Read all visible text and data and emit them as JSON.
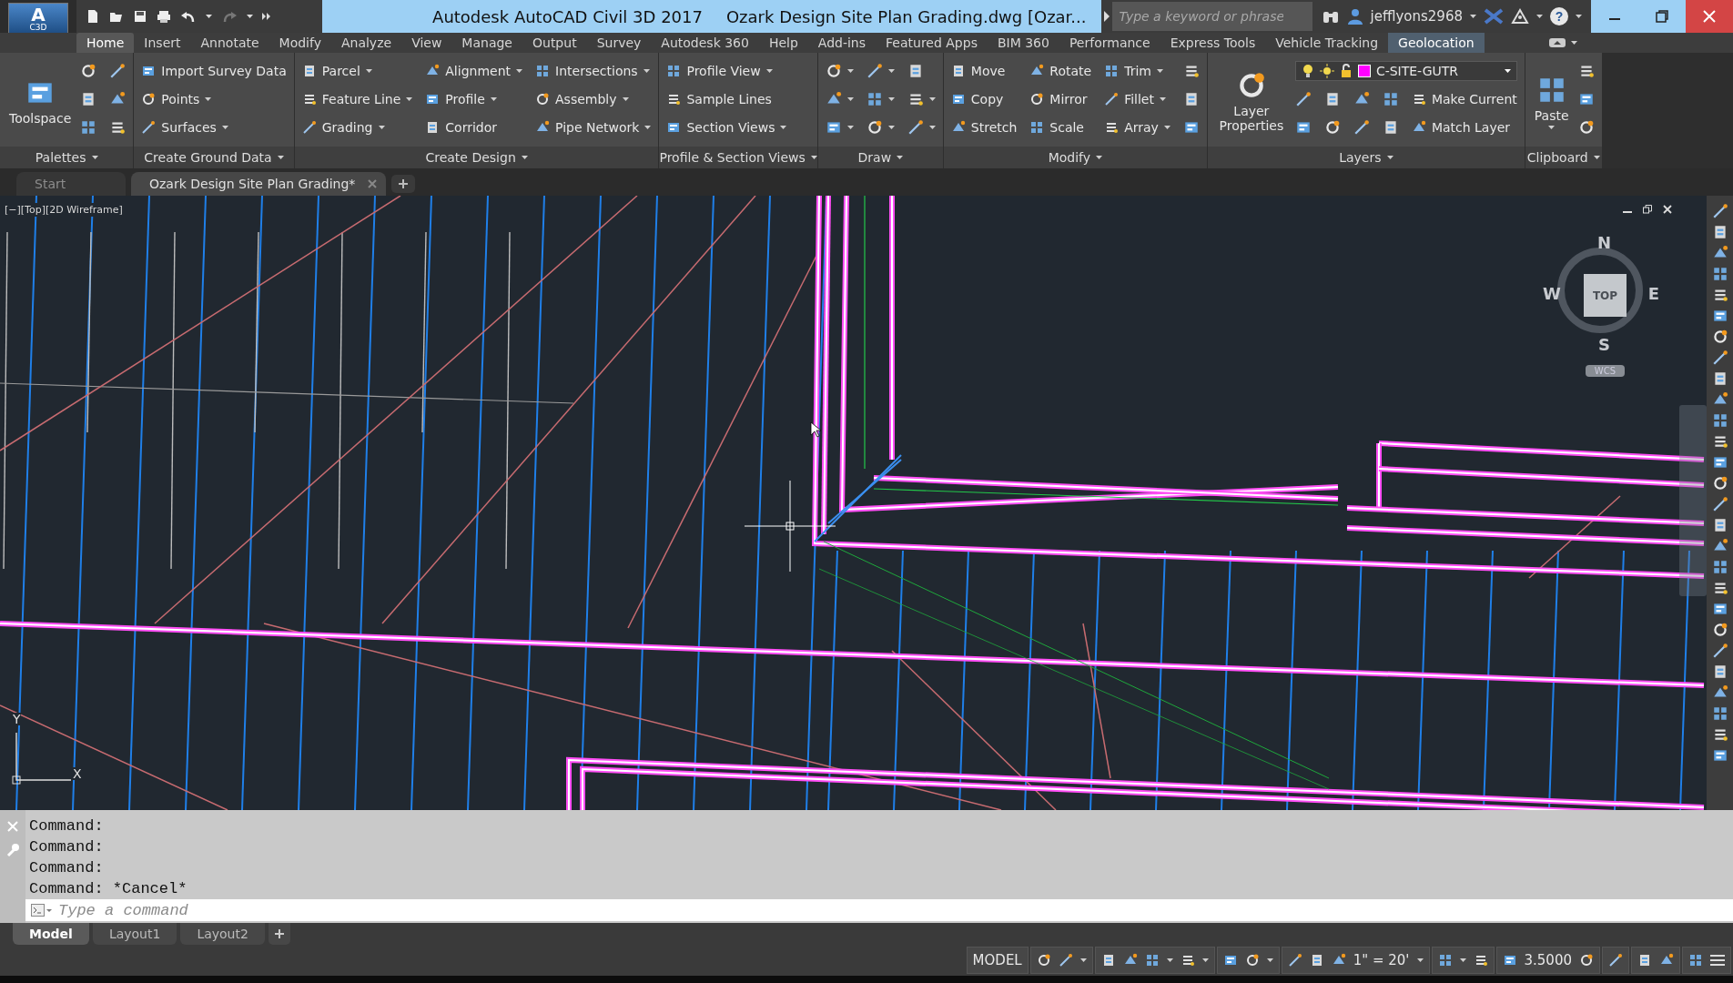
{
  "app_button": {
    "letter": "A",
    "product": "C3D"
  },
  "title": {
    "app": "Autodesk AutoCAD Civil 3D 2017",
    "document": "Ozark Design Site Plan Grading.dwg [Ozar..."
  },
  "search": {
    "placeholder": "Type a keyword or phrase"
  },
  "user": {
    "name": "jefflyons2968"
  },
  "help_button": {
    "label": "?"
  },
  "ribbon_tabs": [
    {
      "label": "Home",
      "selected": true,
      "highlighted": false
    },
    {
      "label": "Insert",
      "selected": false,
      "highlighted": false
    },
    {
      "label": "Annotate",
      "selected": false,
      "highlighted": false
    },
    {
      "label": "Modify",
      "selected": false,
      "highlighted": false
    },
    {
      "label": "Analyze",
      "selected": false,
      "highlighted": false
    },
    {
      "label": "View",
      "selected": false,
      "highlighted": false
    },
    {
      "label": "Manage",
      "selected": false,
      "highlighted": false
    },
    {
      "label": "Output",
      "selected": false,
      "highlighted": false
    },
    {
      "label": "Survey",
      "selected": false,
      "highlighted": false
    },
    {
      "label": "Autodesk 360",
      "selected": false,
      "highlighted": false
    },
    {
      "label": "Help",
      "selected": false,
      "highlighted": false
    },
    {
      "label": "Add-ins",
      "selected": false,
      "highlighted": false
    },
    {
      "label": "Featured Apps",
      "selected": false,
      "highlighted": false
    },
    {
      "label": "BIM 360",
      "selected": false,
      "highlighted": false
    },
    {
      "label": "Performance",
      "selected": false,
      "highlighted": false
    },
    {
      "label": "Express Tools",
      "selected": false,
      "highlighted": false
    },
    {
      "label": "Vehicle Tracking",
      "selected": false,
      "highlighted": false
    },
    {
      "label": "Geolocation",
      "selected": false,
      "highlighted": true
    }
  ],
  "ribbon_panels": [
    {
      "title": "Palettes",
      "large": [
        {
          "label": "Toolspace",
          "dropdown": false
        }
      ],
      "rows": [
        [
          {
            "kind": "icon",
            "dropdown": false
          },
          {
            "kind": "icon",
            "dropdown": false
          }
        ],
        [
          {
            "kind": "icon",
            "dropdown": false
          },
          {
            "kind": "icon",
            "dropdown": false
          }
        ],
        [
          {
            "kind": "icon",
            "dropdown": false
          },
          {
            "kind": "icon",
            "dropdown": false
          }
        ]
      ]
    },
    {
      "title": "Create Ground Data",
      "rows": [
        [
          {
            "kind": "tool",
            "label": "Import Survey Data",
            "dropdown": false
          }
        ],
        [
          {
            "kind": "tool",
            "label": "Points",
            "dropdown": true
          }
        ],
        [
          {
            "kind": "tool",
            "label": "Surfaces",
            "dropdown": true
          }
        ]
      ]
    },
    {
      "title": "Create Design",
      "rows": [
        [
          {
            "kind": "tool",
            "label": "Parcel",
            "dropdown": true
          },
          {
            "kind": "tool",
            "label": "Alignment",
            "dropdown": true
          },
          {
            "kind": "tool",
            "label": "Intersections",
            "dropdown": true
          }
        ],
        [
          {
            "kind": "tool",
            "label": "Feature Line",
            "dropdown": true
          },
          {
            "kind": "tool",
            "label": "Profile",
            "dropdown": true
          },
          {
            "kind": "tool",
            "label": "Assembly",
            "dropdown": true
          }
        ],
        [
          {
            "kind": "tool",
            "label": "Grading",
            "dropdown": true
          },
          {
            "kind": "tool",
            "label": "Corridor",
            "dropdown": false
          },
          {
            "kind": "tool",
            "label": "Pipe Network",
            "dropdown": true
          }
        ]
      ]
    },
    {
      "title": "Profile & Section Views",
      "rows": [
        [
          {
            "kind": "tool",
            "label": "Profile View",
            "dropdown": true
          }
        ],
        [
          {
            "kind": "tool",
            "label": "Sample Lines",
            "dropdown": false
          }
        ],
        [
          {
            "kind": "tool",
            "label": "Section Views",
            "dropdown": true
          }
        ]
      ]
    },
    {
      "title": "Draw",
      "rows": [
        [
          {
            "kind": "icon",
            "dropdown": true
          },
          {
            "kind": "icon",
            "dropdown": true
          },
          {
            "kind": "icon",
            "dropdown": false
          }
        ],
        [
          {
            "kind": "icon",
            "dropdown": true
          },
          {
            "kind": "icon",
            "dropdown": true
          },
          {
            "kind": "icon",
            "dropdown": true
          }
        ],
        [
          {
            "kind": "icon",
            "dropdown": true
          },
          {
            "kind": "icon",
            "dropdown": true
          },
          {
            "kind": "icon",
            "dropdown": true
          }
        ]
      ]
    },
    {
      "title": "Modify",
      "rows": [
        [
          {
            "kind": "tool",
            "label": "Move",
            "dropdown": false
          },
          {
            "kind": "tool",
            "label": "Rotate",
            "dropdown": false
          },
          {
            "kind": "tool",
            "label": "Trim",
            "dropdown": true
          },
          {
            "kind": "icon",
            "dropdown": false
          }
        ],
        [
          {
            "kind": "tool",
            "label": "Copy",
            "dropdown": false
          },
          {
            "kind": "tool",
            "label": "Mirror",
            "dropdown": false
          },
          {
            "kind": "tool",
            "label": "Fillet",
            "dropdown": true
          },
          {
            "kind": "icon",
            "dropdown": false
          }
        ],
        [
          {
            "kind": "tool",
            "label": "Stretch",
            "dropdown": false
          },
          {
            "kind": "tool",
            "label": "Scale",
            "dropdown": false
          },
          {
            "kind": "tool",
            "label": "Array",
            "dropdown": true
          },
          {
            "kind": "icon",
            "dropdown": false
          }
        ]
      ]
    },
    {
      "title": "Layers",
      "large": [
        {
          "label": "Layer Properties",
          "dropdown": false
        }
      ],
      "rows": [
        [
          {
            "kind": "layer",
            "label": "C-SITE-GUTR",
            "color": "#ff00ff",
            "dropdown": true
          }
        ],
        [
          {
            "kind": "icon",
            "dropdown": false
          },
          {
            "kind": "icon",
            "dropdown": false
          },
          {
            "kind": "icon",
            "dropdown": false
          },
          {
            "kind": "icon",
            "dropdown": false
          },
          {
            "kind": "tool",
            "label": "Make Current",
            "dropdown": false
          }
        ],
        [
          {
            "kind": "icon",
            "dropdown": false
          },
          {
            "kind": "icon",
            "dropdown": false
          },
          {
            "kind": "icon",
            "dropdown": false
          },
          {
            "kind": "icon",
            "dropdown": false
          },
          {
            "kind": "tool",
            "label": "Match Layer",
            "dropdown": false
          }
        ]
      ]
    },
    {
      "title": "Clipboard",
      "large": [
        {
          "label": "Paste",
          "dropdown": true
        }
      ],
      "rows": [
        [
          {
            "kind": "icon",
            "dropdown": false
          }
        ],
        [
          {
            "kind": "icon",
            "dropdown": false
          }
        ],
        [
          {
            "kind": "icon",
            "dropdown": false
          }
        ]
      ]
    }
  ],
  "document_tabs": [
    {
      "label": "Start",
      "selected": false
    },
    {
      "label": "Ozark Design Site Plan Grading*",
      "selected": true
    }
  ],
  "viewport": {
    "label": "[−][Top][2D Wireframe]",
    "viewcube": {
      "north": "N",
      "west": "W",
      "east": "E",
      "south": "S",
      "face": "TOP",
      "coordinate_system": "WCS"
    },
    "ucs": {
      "y": "Y",
      "x": "X"
    }
  },
  "command_history": [
    "Command:",
    "Command:",
    "Command:",
    "Command: *Cancel*"
  ],
  "command_input": {
    "placeholder": "Type a command"
  },
  "layout_tabs": [
    {
      "label": "Model",
      "selected": true
    },
    {
      "label": "Layout1",
      "selected": false
    },
    {
      "label": "Layout2",
      "selected": false
    }
  ],
  "status_bar": {
    "space": "MODEL",
    "annotation_scale": "1\" = 20'",
    "value": "3.5000"
  }
}
